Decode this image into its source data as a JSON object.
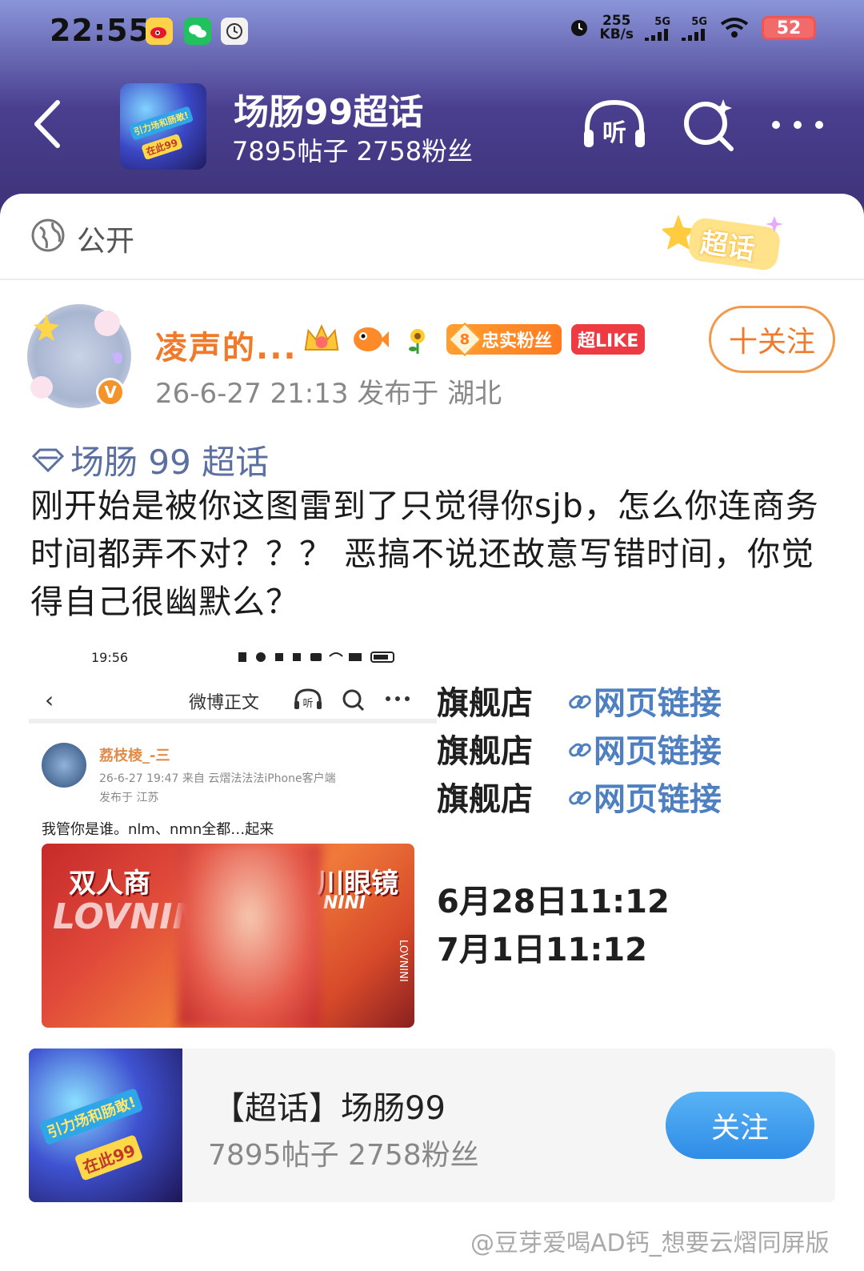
{
  "status_bar": {
    "time": "22:55",
    "net_speed_value": "255",
    "net_speed_unit": "KB/s",
    "signal_1": "5G",
    "signal_2": "5G",
    "battery": "52"
  },
  "header": {
    "title": "场肠99超话",
    "subtitle": "7895帖子 2758粉丝",
    "listen_icon_label": "听",
    "thumb_text_1": "引力场和肠敢!",
    "thumb_text_2": "在此99"
  },
  "visibility": {
    "label": "公开",
    "badge_text": "超话"
  },
  "post": {
    "username": "凌声的...",
    "fan_badge_level": "8",
    "fan_badge_text": "忠实粉丝",
    "super_like_text": "超LIKE",
    "meta": "26-6-27 21:13   发布于 湖北",
    "follow_label": "十关注",
    "topic_tag": "场肠 99 超话",
    "text": "刚开始是被你这图雷到了只觉得你sjb，怎么你连商务时间都弄不对？？？ 恶搞不说还故意写错时间，你觉得自己很幽默么？"
  },
  "embedded_screenshot": {
    "time": "19:56",
    "nav_title": "微博正文",
    "listen_icon_label": "听",
    "name": "荔枝棱_-三",
    "meta_line": "26-6-27 19:47  来自 云熠法法法iPhone客户端",
    "meta_line_2": "发布于 江苏",
    "text": "我管你是谁。nlm、nmn全都…起来",
    "image_text_1": "双人商",
    "image_text_2": "川眼镜",
    "image_text_3": "LOVNINI",
    "image_text_4": "NINI",
    "image_side_text": "LOVNINI"
  },
  "right_rows": [
    {
      "store": "旗舰店",
      "link": "网页链接"
    },
    {
      "store": "旗舰店",
      "link": "网页链接"
    },
    {
      "store": "旗舰店",
      "link": "网页链接"
    }
  ],
  "dates": [
    "6月28日11:12",
    "7月1日11:12"
  ],
  "topic_card": {
    "title": "【超话】场肠99",
    "subtitle": "7895帖子 2758粉丝",
    "follow_label": "关注",
    "thumb_text_1": "引力场和肠敢!",
    "thumb_text_2": "在此99"
  },
  "watermark": "@豆芽爱喝AD钙_想要云熠同屏版",
  "colors": {
    "accent_orange": "#f07a2a",
    "link_blue": "#4e7fc1",
    "follow_blue": "#2f8ce6"
  }
}
